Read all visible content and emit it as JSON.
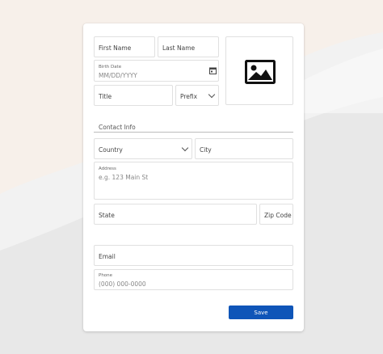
{
  "form": {
    "first_name": {
      "placeholder": "First Name"
    },
    "last_name": {
      "placeholder": "Last Name"
    },
    "birth_date": {
      "label": "Birth Date",
      "placeholder": "MM/DD/YYYY"
    },
    "title": {
      "placeholder": "Title"
    },
    "prefix": {
      "placeholder": "Prefix"
    },
    "photo": {
      "icon": "image-icon"
    },
    "contact_info": {
      "label": "Contact Info"
    },
    "country": {
      "placeholder": "Country"
    },
    "city": {
      "placeholder": "City"
    },
    "address": {
      "label": "Address",
      "placeholder": "e.g. 123 Main St"
    },
    "state": {
      "placeholder": "State"
    },
    "zip": {
      "placeholder": "Zip Code"
    },
    "email": {
      "placeholder": "Email"
    },
    "phone": {
      "label": "Phone",
      "placeholder": "(000) 000-0000"
    },
    "save_label": "Save"
  },
  "colors": {
    "accent": "#0f55b8",
    "background": "#f3f3f3",
    "card": "#ffffff"
  }
}
